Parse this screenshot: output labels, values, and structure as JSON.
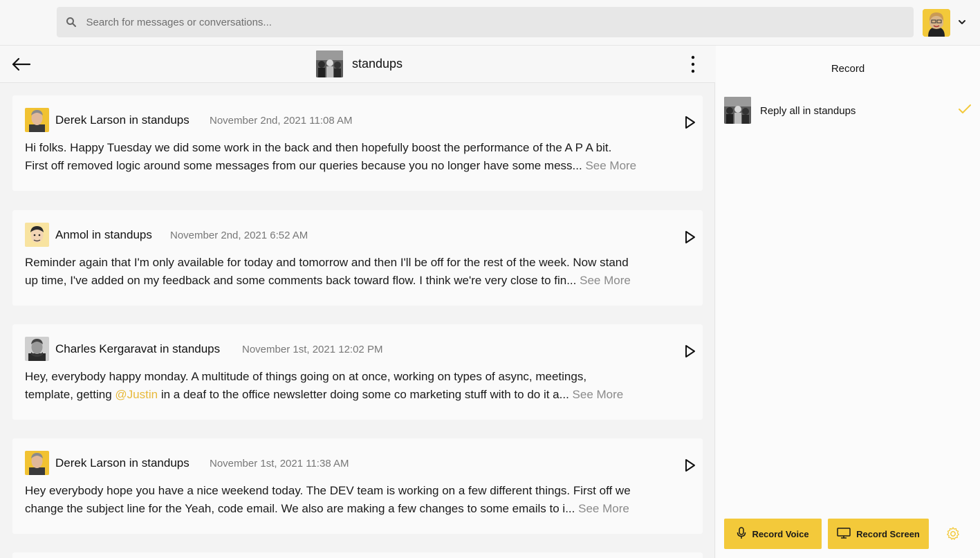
{
  "search": {
    "placeholder": "Search for messages or conversations..."
  },
  "conversation": {
    "channel_name": "standups"
  },
  "messages": [
    {
      "author": "Derek Larson in standups",
      "time": "November 2nd, 2021 11:08 AM",
      "line1": "Hi folks. Happy Tuesday we did some work in the back and then hopefully boost the performance of the A P A bit.",
      "line2": "First off removed logic around some messages from our queries because you no longer have some mess...",
      "see_more": "See More"
    },
    {
      "author": "Anmol in standups",
      "time": "November 2nd, 2021 6:52 AM",
      "line1": "Reminder again that I'm only available for today and tomorrow and then I'll be off for the rest of the week. Now stand",
      "line2": "up time, I've added on my feedback and some comments back toward flow. I think we're very close to fin...",
      "see_more": "See More"
    },
    {
      "author": "Charles Kergaravat in standups",
      "time": "November 1st, 2021 12:02 PM",
      "line1": "Hey, everybody happy monday. A multitude of things going on at once, working on types of async, meetings,",
      "line2_pre": "template, getting ",
      "mention": "@Justin",
      "line2_post": " in a deaf to the office newsletter doing some co marketing stuff with to do it a...",
      "see_more": "See More"
    },
    {
      "author": "Derek Larson in standups",
      "time": "November 1st, 2021 11:38 AM",
      "line1": "Hey everybody hope you have a nice weekend today. The DEV team is working on a few different things. First off we",
      "line2": "change the subject line for the Yeah, code email. We also are making a few changes to some emails to i...",
      "see_more": "See More"
    }
  ],
  "side_panel": {
    "title": "Record",
    "reply_option": "Reply all in standups",
    "record_voice": "Record Voice",
    "record_screen": "Record Screen"
  },
  "colors": {
    "accent": "#f3c93a",
    "mention": "#e8b93a"
  }
}
